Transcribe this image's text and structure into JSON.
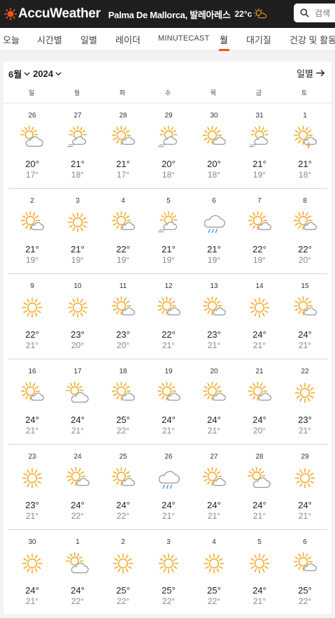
{
  "header": {
    "brand": "AccuWeather",
    "location": "Palma De Mallorca, 발레아레스",
    "current_temp": "22°c",
    "current_icon": "partly-sunny-icon",
    "search_placeholder": "검색"
  },
  "tabs": [
    {
      "label": "오늘"
    },
    {
      "label": "시간별"
    },
    {
      "label": "일별"
    },
    {
      "label": "레이더"
    },
    {
      "label": "MINUTECAST"
    },
    {
      "label": "월"
    },
    {
      "label": "대기질"
    },
    {
      "label": "건강 및 활동"
    }
  ],
  "active_tab": "월",
  "colors": {
    "accent": "#f05514",
    "sun": "#f5a623",
    "cloud": "#9aa0a6",
    "rain": "#5b9bd5"
  },
  "calendar": {
    "month": "6월",
    "year": "2024",
    "daily_link": "일별",
    "weekdays": [
      "일",
      "월",
      "화",
      "수",
      "목",
      "금",
      "토"
    ],
    "weeks": [
      [
        {
          "d": "26",
          "hi": "20°",
          "lo": "17°",
          "icon": "mostly-cloudy"
        },
        {
          "d": "27",
          "hi": "21°",
          "lo": "18°",
          "icon": "partly-cloudy-fog"
        },
        {
          "d": "28",
          "hi": "21°",
          "lo": "17°",
          "icon": "partly-cloudy"
        },
        {
          "d": "29",
          "hi": "20°",
          "lo": "18°",
          "icon": "partly-cloudy-fog"
        },
        {
          "d": "30",
          "hi": "20°",
          "lo": "18°",
          "icon": "partly-cloudy"
        },
        {
          "d": "31",
          "hi": "21°",
          "lo": "19°",
          "icon": "partly-cloudy-fog"
        },
        {
          "d": "1",
          "hi": "21°",
          "lo": "18°",
          "icon": "thunder"
        }
      ],
      [
        {
          "d": "2",
          "hi": "21°",
          "lo": "19°",
          "icon": "partly-cloudy"
        },
        {
          "d": "3",
          "hi": "21°",
          "lo": "19°",
          "icon": "sunny"
        },
        {
          "d": "4",
          "hi": "22°",
          "lo": "19°",
          "icon": "partly-cloudy"
        },
        {
          "d": "5",
          "hi": "21°",
          "lo": "19°",
          "icon": "partly-cloudy-fog"
        },
        {
          "d": "6",
          "hi": "21°",
          "lo": "19°",
          "icon": "rain"
        },
        {
          "d": "7",
          "hi": "22°",
          "lo": "19°",
          "icon": "partly-cloudy"
        },
        {
          "d": "8",
          "hi": "22°",
          "lo": "20°",
          "icon": "partly-cloudy"
        }
      ],
      [
        {
          "d": "9",
          "hi": "22°",
          "lo": "21°",
          "icon": "sunny"
        },
        {
          "d": "10",
          "hi": "23°",
          "lo": "20°",
          "icon": "sunny"
        },
        {
          "d": "11",
          "hi": "23°",
          "lo": "20°",
          "icon": "partly-cloudy"
        },
        {
          "d": "12",
          "hi": "22°",
          "lo": "21°",
          "icon": "partly-cloudy"
        },
        {
          "d": "13",
          "hi": "23°",
          "lo": "21°",
          "icon": "partly-cloudy"
        },
        {
          "d": "14",
          "hi": "24°",
          "lo": "21°",
          "icon": "sunny"
        },
        {
          "d": "15",
          "hi": "24°",
          "lo": "21°",
          "icon": "partly-cloudy"
        }
      ],
      [
        {
          "d": "16",
          "hi": "24°",
          "lo": "21°",
          "icon": "partly-cloudy"
        },
        {
          "d": "17",
          "hi": "24°",
          "lo": "21°",
          "icon": "mostly-cloudy"
        },
        {
          "d": "18",
          "hi": "25°",
          "lo": "22°",
          "icon": "partly-cloudy"
        },
        {
          "d": "19",
          "hi": "24°",
          "lo": "21°",
          "icon": "partly-cloudy"
        },
        {
          "d": "20",
          "hi": "24°",
          "lo": "21°",
          "icon": "partly-cloudy"
        },
        {
          "d": "21",
          "hi": "24°",
          "lo": "20°",
          "icon": "partly-cloudy"
        },
        {
          "d": "22",
          "hi": "23°",
          "lo": "21°",
          "icon": "sunny"
        }
      ],
      [
        {
          "d": "23",
          "hi": "23°",
          "lo": "21°",
          "icon": "sunny"
        },
        {
          "d": "24",
          "hi": "24°",
          "lo": "22°",
          "icon": "partly-cloudy"
        },
        {
          "d": "25",
          "hi": "24°",
          "lo": "22°",
          "icon": "partly-cloudy"
        },
        {
          "d": "26",
          "hi": "24°",
          "lo": "21°",
          "icon": "rain"
        },
        {
          "d": "27",
          "hi": "24°",
          "lo": "21°",
          "icon": "partly-cloudy"
        },
        {
          "d": "28",
          "hi": "24°",
          "lo": "21°",
          "icon": "mostly-cloudy"
        },
        {
          "d": "29",
          "hi": "24°",
          "lo": "21°",
          "icon": "sunny"
        }
      ],
      [
        {
          "d": "30",
          "hi": "24°",
          "lo": "21°",
          "icon": "sunny"
        },
        {
          "d": "1",
          "hi": "24°",
          "lo": "22°",
          "icon": "mostly-cloudy"
        },
        {
          "d": "2",
          "hi": "25°",
          "lo": "22°",
          "icon": "sunny"
        },
        {
          "d": "3",
          "hi": "25°",
          "lo": "22°",
          "icon": "sunny"
        },
        {
          "d": "4",
          "hi": "25°",
          "lo": "22°",
          "icon": "sunny"
        },
        {
          "d": "5",
          "hi": "24°",
          "lo": "21°",
          "icon": "sunny"
        },
        {
          "d": "6",
          "hi": "25°",
          "lo": "22°",
          "icon": "partly-cloudy"
        }
      ]
    ]
  }
}
